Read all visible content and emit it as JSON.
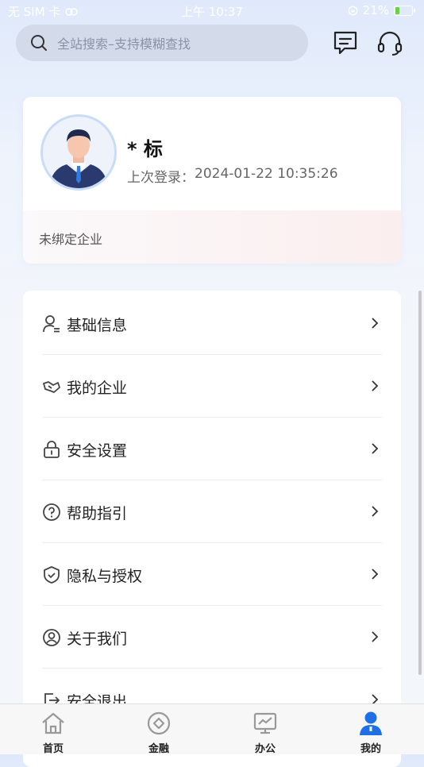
{
  "status_bar": {
    "carrier": "无 SIM 卡",
    "time": "上午 10:37",
    "battery": "21%"
  },
  "header": {
    "search_placeholder": "全站搜索–支持模糊查找",
    "icons": [
      "message-icon",
      "customer-service-icon"
    ]
  },
  "profile": {
    "name": "* 标",
    "last_login_label": "上次登录：",
    "last_login_time": "2024-01-22 10:35:26",
    "company_status": "未绑定企业"
  },
  "menu": {
    "items": [
      {
        "label": "基础信息",
        "icon": "user-info-icon"
      },
      {
        "label": "我的企业",
        "icon": "handshake-icon"
      },
      {
        "label": "安全设置",
        "icon": "lock-icon"
      },
      {
        "label": "帮助指引",
        "icon": "help-icon"
      },
      {
        "label": "隐私与授权",
        "icon": "shield-icon"
      },
      {
        "label": "关于我们",
        "icon": "about-icon"
      },
      {
        "label": "安全退出",
        "icon": "logout-icon"
      }
    ]
  },
  "tabs": [
    {
      "label": "首页",
      "icon": "home-icon",
      "active": false
    },
    {
      "label": "金融",
      "icon": "finance-icon",
      "active": false
    },
    {
      "label": "办公",
      "icon": "office-icon",
      "active": false
    },
    {
      "label": "我的",
      "icon": "profile-icon",
      "active": true
    }
  ],
  "colors": {
    "accent": "#1f6fe5",
    "icon_gray": "#999999"
  }
}
